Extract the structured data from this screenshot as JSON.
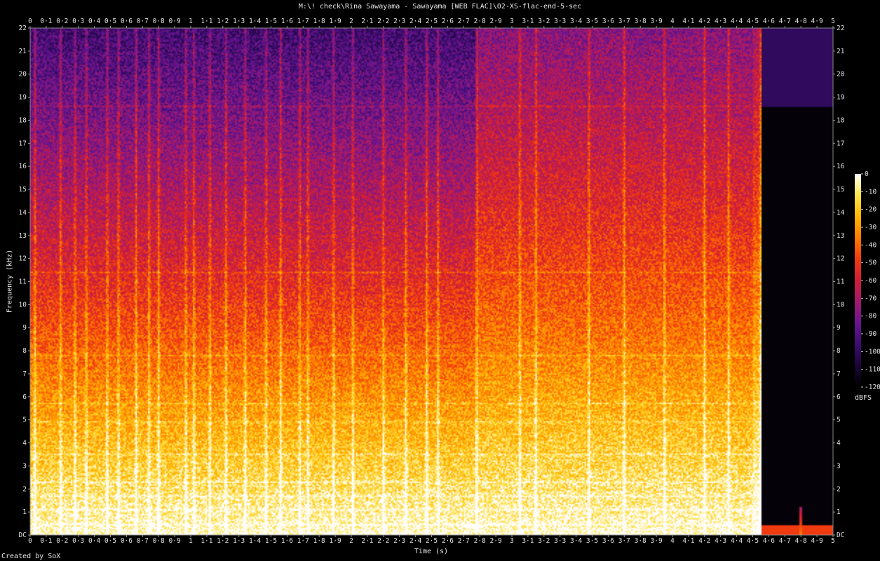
{
  "window": {
    "title": "M:\\! check\\Rina Sawayama - Sawayama [WEB FLAC]\\02-XS-flac-end-5-sec",
    "credit": "Created by SoX"
  },
  "chart_data": {
    "type": "heatmap",
    "title": "M:\\! check\\Rina Sawayama - Sawayama [WEB FLAC]\\02-XS-flac-end-5-sec",
    "xlabel": "Time (s)",
    "ylabel": "Frequency (kHz)",
    "xlim": [
      0,
      5
    ],
    "ylim": [
      0,
      22
    ],
    "x_ticks": [
      "0",
      "0·1",
      "0·2",
      "0·3",
      "0·4",
      "0·5",
      "0·6",
      "0·7",
      "0·8",
      "0·9",
      "1",
      "1·1",
      "1·2",
      "1·3",
      "1·4",
      "1·5",
      "1·6",
      "1·7",
      "1·8",
      "1·9",
      "2",
      "2·1",
      "2·2",
      "2·3",
      "2·4",
      "2·5",
      "2·6",
      "2·7",
      "2·8",
      "2·9",
      "3",
      "3·1",
      "3·2",
      "3·3",
      "3·4",
      "3·5",
      "3·6",
      "3·7",
      "3·8",
      "3·9",
      "4",
      "4·1",
      "4·2",
      "4·3",
      "4·4",
      "4·5",
      "4·6",
      "4·7",
      "4·8",
      "4·9",
      "5"
    ],
    "y_ticks": [
      "DC",
      "1",
      "2",
      "3",
      "4",
      "5",
      "6",
      "7",
      "8",
      "9",
      "10",
      "11",
      "12",
      "13",
      "14",
      "15",
      "16",
      "17",
      "18",
      "19",
      "20",
      "21",
      "22"
    ],
    "colorbar": {
      "unit": "dBFS",
      "ticks": [
        "0",
        "-10",
        "-20",
        "-30",
        "-40",
        "-50",
        "-60",
        "-70",
        "-80",
        "-90",
        "-100",
        "-110",
        "-120"
      ],
      "range": [
        -120,
        0
      ],
      "colors": [
        "#000000",
        "#1a0535",
        "#3b0c70",
        "#6a1590",
        "#a01a70",
        "#d01c38",
        "#f03a10",
        "#ff7a00",
        "#ffb400",
        "#ffe24a",
        "#ffffff"
      ]
    },
    "segments": [
      {
        "t_start": 0.0,
        "t_end": 2.78,
        "level_top_db": -95,
        "bright_to_khz": 11
      },
      {
        "t_start": 2.78,
        "t_end": 4.55,
        "level_top_db": -78,
        "bright_to_khz": 9
      },
      {
        "t_start": 4.55,
        "t_end": 5.0,
        "level_top_db": -120,
        "bright_to_khz": 0
      }
    ],
    "transients_s": [
      0.03,
      0.19,
      0.28,
      0.35,
      0.48,
      0.55,
      0.66,
      0.74,
      0.8,
      0.97,
      1.02,
      1.12,
      1.22,
      1.34,
      1.47,
      1.56,
      1.68,
      1.73,
      1.89,
      2.01,
      2.2,
      2.34,
      2.47,
      2.54,
      2.78,
      3.05,
      3.15,
      3.48,
      3.7,
      3.95,
      4.2,
      4.35,
      4.55
    ],
    "tones_khz": [
      0.45,
      1.1,
      1.7,
      2.3,
      3.5,
      4.9,
      5.7,
      7.8,
      11.4,
      18.6
    ]
  }
}
